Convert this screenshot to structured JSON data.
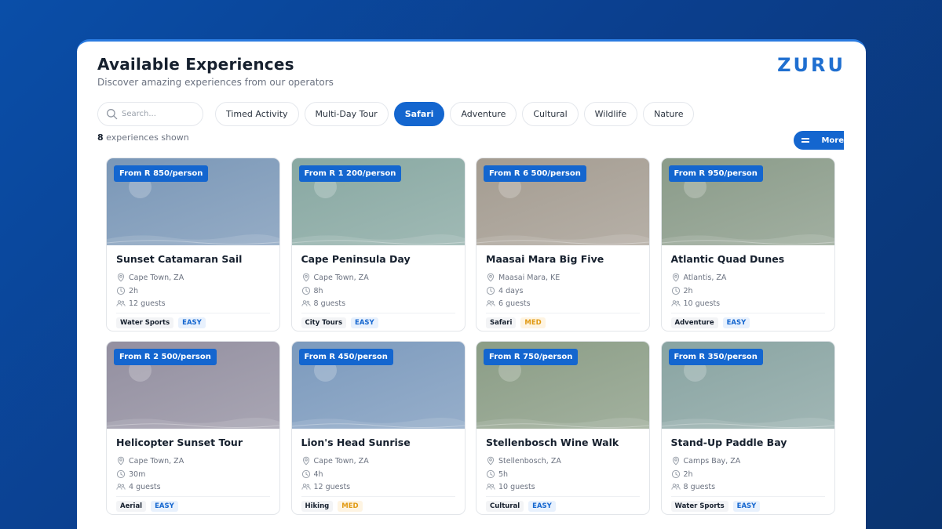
{
  "header": {
    "title": "Available Experiences",
    "subtitle": "Discover amazing experiences from our operators",
    "logo": "ZURU"
  },
  "search": {
    "placeholder": "Search...",
    "value": ""
  },
  "filters": [
    {
      "label": "Timed Activity",
      "active": false
    },
    {
      "label": "Multi-Day Tour",
      "active": false
    },
    {
      "label": "Safari",
      "active": true
    },
    {
      "label": "Adventure",
      "active": false
    },
    {
      "label": "Cultural",
      "active": false
    },
    {
      "label": "Wildlife",
      "active": false
    },
    {
      "label": "Nature",
      "active": false
    }
  ],
  "results": {
    "count": "8",
    "suffix": "experiences shown"
  },
  "more_button": {
    "label": "More"
  },
  "colors": {
    "accent": "#1466cf",
    "easy_text": "#1466cf",
    "med_text": "#e19a12"
  },
  "experiences": [
    {
      "price": "From R 850/person",
      "title": "Sunset Catamaran Sail",
      "location": "Cape Town, ZA",
      "duration": "2h",
      "guests": "12 guests",
      "category": "Water Sports",
      "difficulty": "EASY",
      "image_color": "#7a97b7"
    },
    {
      "price": "From R 1 200/person",
      "title": "Cape Peninsula Day",
      "location": "Cape Town, ZA",
      "duration": "8h",
      "guests": "8 guests",
      "category": "City Tours",
      "difficulty": "EASY",
      "image_color": "#88a8a2"
    },
    {
      "price": "From R 6 500/person",
      "title": "Maasai Mara Big Five",
      "location": "Maasai Mara, KE",
      "duration": "4 days",
      "guests": "6 guests",
      "category": "Safari",
      "difficulty": "MED",
      "image_color": "#a49c91"
    },
    {
      "price": "From R 950/person",
      "title": "Atlantic Quad Dunes",
      "location": "Atlantis, ZA",
      "duration": "2h",
      "guests": "10 guests",
      "category": "Adventure",
      "difficulty": "EASY",
      "image_color": "#8a9b89"
    },
    {
      "price": "From R 2 500/person",
      "title": "Helicopter Sunset Tour",
      "location": "Cape Town, ZA",
      "duration": "30m",
      "guests": "4 guests",
      "category": "Aerial",
      "difficulty": "EASY",
      "image_color": "#938fa0"
    },
    {
      "price": "From R 450/person",
      "title": "Lion's Head Sunrise",
      "location": "Cape Town, ZA",
      "duration": "4h",
      "guests": "12 guests",
      "category": "Hiking",
      "difficulty": "MED",
      "image_color": "#7c9abd"
    },
    {
      "price": "From R 750/person",
      "title": "Stellenbosch Wine Walk",
      "location": "Stellenbosch, ZA",
      "duration": "5h",
      "guests": "10 guests",
      "category": "Cultural",
      "difficulty": "EASY",
      "image_color": "#8b9d86"
    },
    {
      "price": "From R 350/person",
      "title": "Stand-Up Paddle Bay",
      "location": "Camps Bay, ZA",
      "duration": "2h",
      "guests": "8 guests",
      "category": "Water Sports",
      "difficulty": "EASY",
      "image_color": "#89a4a2"
    }
  ]
}
